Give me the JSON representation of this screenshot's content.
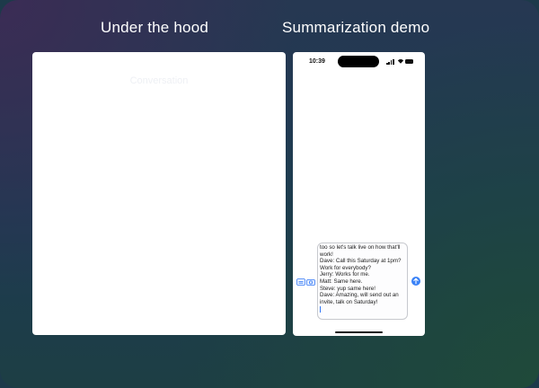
{
  "headings": {
    "left": "Under the hood",
    "right": "Summarization demo"
  },
  "left_panel": {
    "ghost_label": "Conversation"
  },
  "phone": {
    "status_time": "10:39",
    "message_lines": [
      "too so let's talk live on how that'll",
      "work!",
      "Dave: Call this Saturday at 1pm?",
      "Work for everybody?",
      "Jerry: Works for me.",
      "Matt: Same here.",
      "Steve: yup same here!",
      "Dave: Amazing, will send out an",
      "invite, talk on Saturday!"
    ],
    "accent_color": "#3a82f7"
  }
}
